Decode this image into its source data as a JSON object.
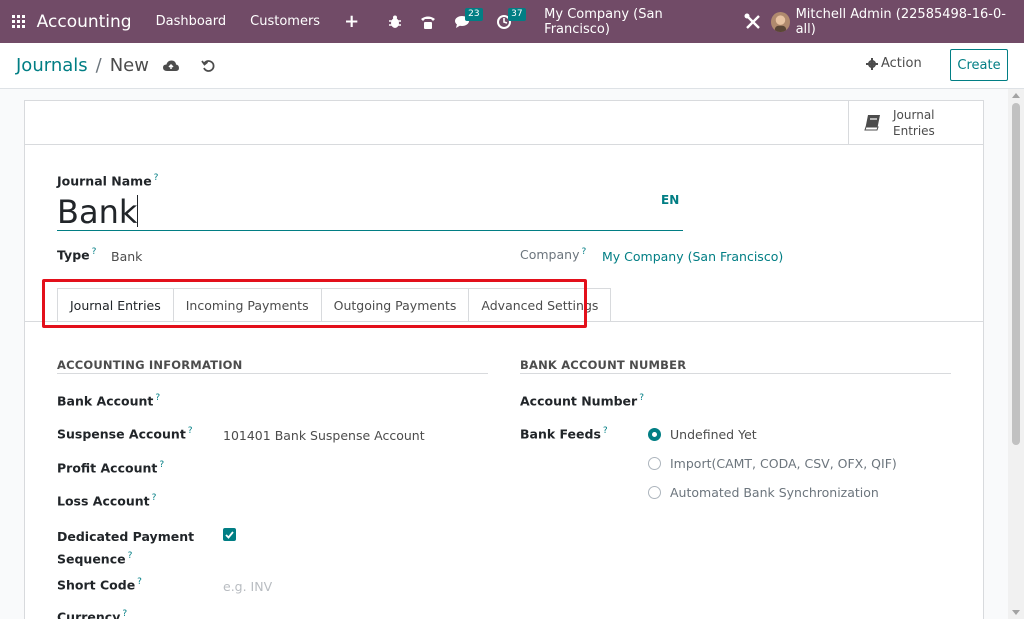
{
  "navbar": {
    "app_title": "Accounting",
    "menu": [
      "Dashboard",
      "Customers"
    ],
    "messages_count": "23",
    "activities_count": "37",
    "company": "My Company (San Francisco)",
    "user": "Mitchell Admin (22585498-16-0-all)"
  },
  "breadcrumb": {
    "parent": "Journals",
    "current": "New"
  },
  "control": {
    "action_label": "Action",
    "create_label": "Create"
  },
  "smart_button": {
    "line1": "Journal",
    "line2": "Entries"
  },
  "form": {
    "journal_name_label": "Journal Name",
    "journal_name_value": "Bank",
    "lang": "EN",
    "type_label": "Type",
    "type_value": "Bank",
    "company_label": "Company",
    "company_value": "My Company (San Francisco)",
    "help_mark": "?"
  },
  "tabs": [
    "Journal Entries",
    "Incoming Payments",
    "Outgoing Payments",
    "Advanced Settings"
  ],
  "accounting": {
    "title": "ACCOUNTING INFORMATION",
    "bank_account_label": "Bank Account",
    "suspense_account_label": "Suspense Account",
    "suspense_account_value": "101401 Bank Suspense Account",
    "profit_account_label": "Profit Account",
    "loss_account_label": "Loss Account",
    "dedicated_seq_label_1": "Dedicated Payment",
    "dedicated_seq_label_2": "Sequence",
    "short_code_label": "Short Code",
    "short_code_placeholder": "e.g. INV",
    "currency_label": "Currency"
  },
  "bank": {
    "title": "BANK ACCOUNT NUMBER",
    "account_number_label": "Account Number",
    "bank_feeds_label": "Bank Feeds",
    "feed_options": [
      "Undefined Yet",
      "Import(CAMT, CODA, CSV, OFX, QIF)",
      "Automated Bank Synchronization"
    ]
  },
  "colors": {
    "brand": "#714b67",
    "accent": "#017e84",
    "highlight": "#e3101b"
  }
}
